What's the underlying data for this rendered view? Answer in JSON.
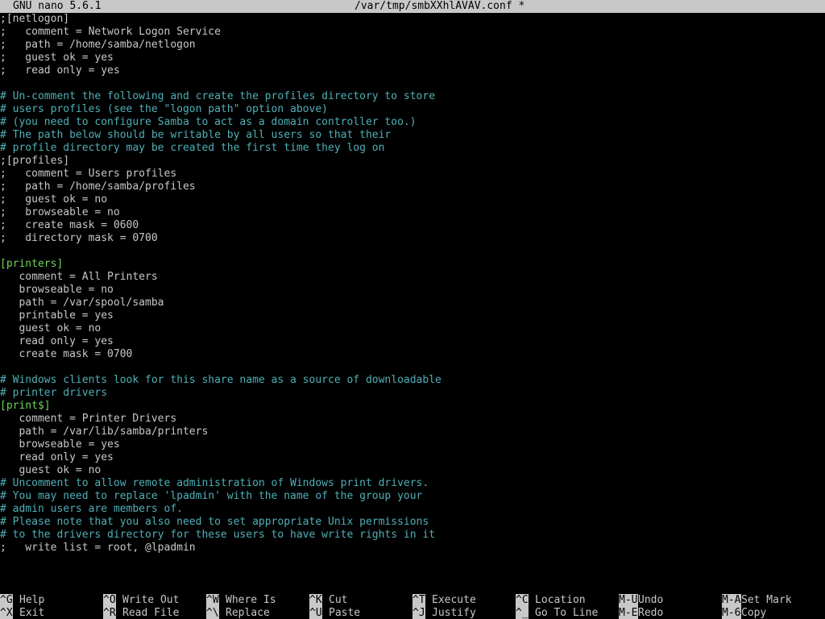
{
  "titlebar": {
    "app": "GNU nano 5.6.1",
    "file": "/var/tmp/smbXXhlAVAV.conf *"
  },
  "editor": {
    "lines": [
      {
        "text": ";[netlogon]",
        "kind": "normal"
      },
      {
        "text": ";   comment = Network Logon Service",
        "kind": "normal"
      },
      {
        "text": ";   path = /home/samba/netlogon",
        "kind": "normal"
      },
      {
        "text": ";   guest ok = yes",
        "kind": "normal"
      },
      {
        "text": ";   read only = yes",
        "kind": "normal"
      },
      {
        "text": "",
        "kind": "normal"
      },
      {
        "text": "# Un-comment the following and create the profiles directory to store",
        "kind": "comment"
      },
      {
        "text": "# users profiles (see the \"logon path\" option above)",
        "kind": "comment"
      },
      {
        "text": "# (you need to configure Samba to act as a domain controller too.)",
        "kind": "comment"
      },
      {
        "text": "# The path below should be writable by all users so that their",
        "kind": "comment"
      },
      {
        "text": "# profile directory may be created the first time they log on",
        "kind": "comment"
      },
      {
        "text": ";[profiles]",
        "kind": "normal"
      },
      {
        "text": ";   comment = Users profiles",
        "kind": "normal"
      },
      {
        "text": ";   path = /home/samba/profiles",
        "kind": "normal"
      },
      {
        "text": ";   guest ok = no",
        "kind": "normal"
      },
      {
        "text": ";   browseable = no",
        "kind": "normal"
      },
      {
        "text": ";   create mask = 0600",
        "kind": "normal"
      },
      {
        "text": ";   directory mask = 0700",
        "kind": "normal"
      },
      {
        "text": "",
        "kind": "normal"
      },
      {
        "text": "[printers]",
        "kind": "section"
      },
      {
        "text": "   comment = All Printers",
        "kind": "normal"
      },
      {
        "text": "   browseable = no",
        "kind": "normal"
      },
      {
        "text": "   path = /var/spool/samba",
        "kind": "normal"
      },
      {
        "text": "   printable = yes",
        "kind": "normal"
      },
      {
        "text": "   guest ok = no",
        "kind": "normal"
      },
      {
        "text": "   read only = yes",
        "kind": "normal"
      },
      {
        "text": "   create mask = 0700",
        "kind": "normal"
      },
      {
        "text": "",
        "kind": "normal"
      },
      {
        "text": "# Windows clients look for this share name as a source of downloadable",
        "kind": "comment"
      },
      {
        "text": "# printer drivers",
        "kind": "comment"
      },
      {
        "text": "[print$]",
        "kind": "section"
      },
      {
        "text": "   comment = Printer Drivers",
        "kind": "normal"
      },
      {
        "text": "   path = /var/lib/samba/printers",
        "kind": "normal"
      },
      {
        "text": "   browseable = yes",
        "kind": "normal"
      },
      {
        "text": "   read only = yes",
        "kind": "normal"
      },
      {
        "text": "   guest ok = no",
        "kind": "normal"
      },
      {
        "text": "# Uncomment to allow remote administration of Windows print drivers.",
        "kind": "comment"
      },
      {
        "text": "# You may need to replace 'lpadmin' with the name of the group your",
        "kind": "comment"
      },
      {
        "text": "# admin users are members of.",
        "kind": "comment"
      },
      {
        "text": "# Please note that you also need to set appropriate Unix permissions",
        "kind": "comment"
      },
      {
        "text": "# to the drivers directory for these users to have write rights in it",
        "kind": "comment"
      },
      {
        "text": ";   write list = root, @lpadmin",
        "kind": "normal"
      }
    ]
  },
  "helpbar": {
    "items": [
      {
        "key": "^G",
        "label": "Help",
        "name": "help"
      },
      {
        "key": "^X",
        "label": "Exit",
        "name": "exit"
      },
      {
        "key": "^O",
        "label": "Write Out",
        "name": "write-out"
      },
      {
        "key": "^R",
        "label": "Read File",
        "name": "read-file"
      },
      {
        "key": "^W",
        "label": "Where Is",
        "name": "where-is"
      },
      {
        "key": "^\\",
        "label": "Replace",
        "name": "replace"
      },
      {
        "key": "^K",
        "label": "Cut",
        "name": "cut"
      },
      {
        "key": "^U",
        "label": "Paste",
        "name": "paste"
      },
      {
        "key": "^T",
        "label": "Execute",
        "name": "execute"
      },
      {
        "key": "^J",
        "label": "Justify",
        "name": "justify"
      },
      {
        "key": "^C",
        "label": "Location",
        "name": "location"
      },
      {
        "key": "^_",
        "label": "Go To Line",
        "name": "go-to-line"
      },
      {
        "key": "M-U",
        "label": "Undo",
        "name": "undo"
      },
      {
        "key": "M-E",
        "label": "Redo",
        "name": "redo"
      },
      {
        "key": "M-A",
        "label": "Set Mark",
        "name": "set-mark"
      },
      {
        "key": "M-6",
        "label": "Copy",
        "name": "copy"
      }
    ]
  },
  "colors": {
    "background": "#000000",
    "text": "#c8c8c8",
    "comment": "#4fb0b8",
    "section": "#6ed35a",
    "titlebar_bg": "#c8c8c8"
  }
}
